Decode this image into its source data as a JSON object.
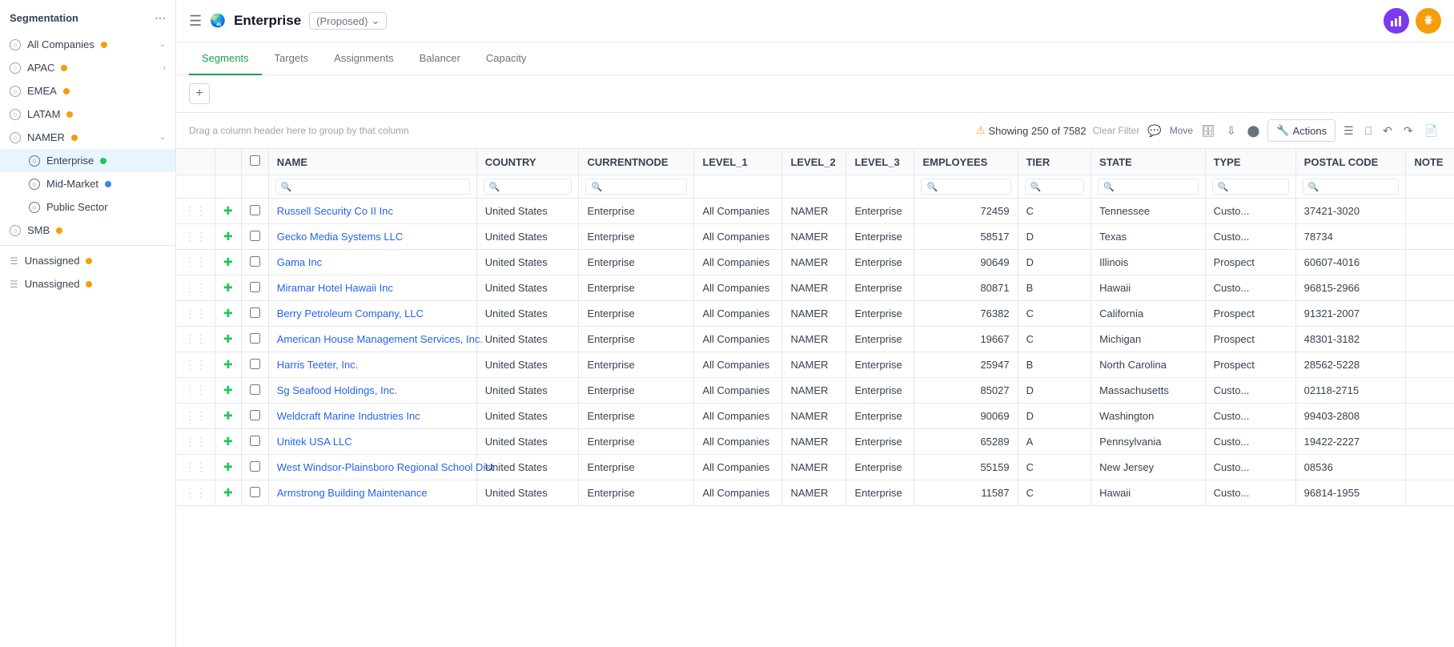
{
  "sidebar": {
    "title": "Segmentation",
    "items": [
      {
        "id": "all-companies",
        "label": "All Companies",
        "dot": "yellow",
        "chevron": true,
        "indent": 0
      },
      {
        "id": "apac",
        "label": "APAC",
        "dot": "yellow",
        "chevron_right": true,
        "indent": 0
      },
      {
        "id": "emea",
        "label": "EMEA",
        "dot": "yellow",
        "chevron_right": false,
        "indent": 0
      },
      {
        "id": "latam",
        "label": "LATAM",
        "dot": "yellow",
        "chevron_right": false,
        "indent": 0
      },
      {
        "id": "namer",
        "label": "NAMER",
        "dot": "yellow",
        "chevron": true,
        "indent": 0
      },
      {
        "id": "enterprise",
        "label": "Enterprise",
        "dot": "green",
        "indent": 1,
        "active": true
      },
      {
        "id": "mid-market",
        "label": "Mid-Market",
        "dot": "blue",
        "indent": 1
      },
      {
        "id": "public-sector",
        "label": "Public Sector",
        "indent": 1
      },
      {
        "id": "smb",
        "label": "SMB",
        "dot": "yellow",
        "indent": 0
      },
      {
        "id": "unassigned-1",
        "label": "Unassigned",
        "dot": "yellow",
        "indent": 0,
        "type": "unassigned"
      },
      {
        "id": "unassigned-2",
        "label": "Unassigned",
        "dot": "yellow",
        "indent": 0,
        "type": "unassigned2"
      }
    ]
  },
  "topbar": {
    "title": "Enterprise",
    "badge": "(Proposed)",
    "btn1_color": "#7c3aed",
    "btn2_color": "#f59e0b"
  },
  "tabs": [
    {
      "id": "segments",
      "label": "Segments",
      "active": true
    },
    {
      "id": "targets",
      "label": "Targets",
      "active": false
    },
    {
      "id": "assignments",
      "label": "Assignments",
      "active": false
    },
    {
      "id": "balancer",
      "label": "Balancer",
      "active": false
    },
    {
      "id": "capacity",
      "label": "Capacity",
      "active": false
    }
  ],
  "toolbar": {
    "drag_hint": "Drag a column header here to group by that column",
    "showing": "Showing 250 of 7582",
    "actions_label": "Actions",
    "clear_filter": "Clear Filter",
    "move": "Move"
  },
  "table": {
    "columns": [
      {
        "id": "drag",
        "label": ""
      },
      {
        "id": "add",
        "label": ""
      },
      {
        "id": "check",
        "label": ""
      },
      {
        "id": "name",
        "label": "NAME"
      },
      {
        "id": "country",
        "label": "COUNTRY"
      },
      {
        "id": "currentnode",
        "label": "CURRENTNODE"
      },
      {
        "id": "level_1",
        "label": "LEVEL_1"
      },
      {
        "id": "level_2",
        "label": "LEVEL_2"
      },
      {
        "id": "level_3",
        "label": "LEVEL_3"
      },
      {
        "id": "employees",
        "label": "EMPLOYEES"
      },
      {
        "id": "tier",
        "label": "TIER"
      },
      {
        "id": "state",
        "label": "STATE"
      },
      {
        "id": "type",
        "label": "TYPE"
      },
      {
        "id": "postal_code",
        "label": "POSTAL CODE"
      },
      {
        "id": "note",
        "label": "NOTE"
      }
    ],
    "rows": [
      {
        "name": "Russell Security Co II Inc",
        "country": "United States",
        "currentnode": "Enterprise",
        "level_1": "All Companies",
        "level_2": "NAMER",
        "level_3": "Enterprise",
        "employees": "72459",
        "tier": "C",
        "state": "Tennessee",
        "type": "Custo...",
        "postal_code": "37421-3020",
        "note": ""
      },
      {
        "name": "Gecko Media Systems LLC",
        "country": "United States",
        "currentnode": "Enterprise",
        "level_1": "All Companies",
        "level_2": "NAMER",
        "level_3": "Enterprise",
        "employees": "58517",
        "tier": "D",
        "state": "Texas",
        "type": "Custo...",
        "postal_code": "78734",
        "note": ""
      },
      {
        "name": "Gama Inc",
        "country": "United States",
        "currentnode": "Enterprise",
        "level_1": "All Companies",
        "level_2": "NAMER",
        "level_3": "Enterprise",
        "employees": "90649",
        "tier": "D",
        "state": "Illinois",
        "type": "Prospect",
        "postal_code": "60607-4016",
        "note": ""
      },
      {
        "name": "Miramar Hotel Hawaii Inc",
        "country": "United States",
        "currentnode": "Enterprise",
        "level_1": "All Companies",
        "level_2": "NAMER",
        "level_3": "Enterprise",
        "employees": "80871",
        "tier": "B",
        "state": "Hawaii",
        "type": "Custo...",
        "postal_code": "96815-2966",
        "note": ""
      },
      {
        "name": "Berry Petroleum Company, LLC",
        "country": "United States",
        "currentnode": "Enterprise",
        "level_1": "All Companies",
        "level_2": "NAMER",
        "level_3": "Enterprise",
        "employees": "76382",
        "tier": "C",
        "state": "California",
        "type": "Prospect",
        "postal_code": "91321-2007",
        "note": ""
      },
      {
        "name": "American House Management Services, Inc.",
        "country": "United States",
        "currentnode": "Enterprise",
        "level_1": "All Companies",
        "level_2": "NAMER",
        "level_3": "Enterprise",
        "employees": "19667",
        "tier": "C",
        "state": "Michigan",
        "type": "Prospect",
        "postal_code": "48301-3182",
        "note": ""
      },
      {
        "name": "Harris Teeter, Inc.",
        "country": "United States",
        "currentnode": "Enterprise",
        "level_1": "All Companies",
        "level_2": "NAMER",
        "level_3": "Enterprise",
        "employees": "25947",
        "tier": "B",
        "state": "North Carolina",
        "type": "Prospect",
        "postal_code": "28562-5228",
        "note": ""
      },
      {
        "name": "Sg Seafood Holdings, Inc.",
        "country": "United States",
        "currentnode": "Enterprise",
        "level_1": "All Companies",
        "level_2": "NAMER",
        "level_3": "Enterprise",
        "employees": "85027",
        "tier": "D",
        "state": "Massachusetts",
        "type": "Custo...",
        "postal_code": "02118-2715",
        "note": ""
      },
      {
        "name": "Weldcraft Marine Industries Inc",
        "country": "United States",
        "currentnode": "Enterprise",
        "level_1": "All Companies",
        "level_2": "NAMER",
        "level_3": "Enterprise",
        "employees": "90069",
        "tier": "D",
        "state": "Washington",
        "type": "Custo...",
        "postal_code": "99403-2808",
        "note": ""
      },
      {
        "name": "Unitek USA LLC",
        "country": "United States",
        "currentnode": "Enterprise",
        "level_1": "All Companies",
        "level_2": "NAMER",
        "level_3": "Enterprise",
        "employees": "65289",
        "tier": "A",
        "state": "Pennsylvania",
        "type": "Custo...",
        "postal_code": "19422-2227",
        "note": ""
      },
      {
        "name": "West Windsor-Plainsboro Regional School Dist",
        "country": "United States",
        "currentnode": "Enterprise",
        "level_1": "All Companies",
        "level_2": "NAMER",
        "level_3": "Enterprise",
        "employees": "55159",
        "tier": "C",
        "state": "New Jersey",
        "type": "Custo...",
        "postal_code": "08536",
        "note": ""
      },
      {
        "name": "Armstrong Building Maintenance",
        "country": "United States",
        "currentnode": "Enterprise",
        "level_1": "All Companies",
        "level_2": "NAMER",
        "level_3": "Enterprise",
        "employees": "11587",
        "tier": "C",
        "state": "Hawaii",
        "type": "Custo...",
        "postal_code": "96814-1955",
        "note": ""
      }
    ]
  }
}
